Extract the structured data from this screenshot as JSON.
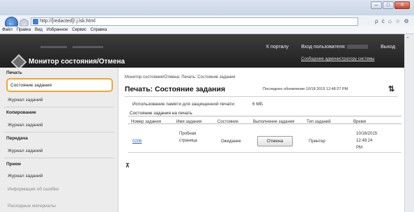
{
  "browser": {
    "url": "http://[redacted]/.j.lsk.html",
    "tools": [
      "ρ",
      "ċ",
      "⌂",
      "☆",
      "⚙"
    ],
    "window_buttons": [
      "–",
      "□",
      "✕"
    ],
    "menu": [
      "Файл",
      "Правка",
      "Вид",
      "Избранное",
      "Сервис",
      "Справка"
    ]
  },
  "header": {
    "title": "Монитор состояния/Отмена",
    "portal_link": "К порталу",
    "login_label": "Вход пользователя:",
    "logout_link": "Выход",
    "admin_message_link": "Сообщение администратору системы"
  },
  "sidebar": {
    "print_head": "Печать",
    "print_job_status": "Состояние задания",
    "print_job_log": "Журнал заданий",
    "copy_head": "Копирование",
    "copy_job_log": "Журнал заданий",
    "transmit_head": "Передача",
    "transmit_job_log": "Журнал заданий",
    "receive_head": "Прием",
    "receive_job_log": "Журнал заданий",
    "error_info": "Информация об ошибке",
    "consumables": "Расходные материалы"
  },
  "main": {
    "breadcrumb": "Монитор состояния/Отмена: Печать: Состояние задания",
    "title": "Печать: Состояние задания",
    "last_updated": "Последнее обновление:10/18 2015 12:48:27 PM",
    "memory_label": "Использование памяти для защищенной печати:",
    "memory_value": "6 MБ",
    "table_heading": "Состояние задания на печать",
    "columns": [
      "Номер задания",
      "Имя задания",
      "Состояние",
      "Выполнение задания",
      "Тип заданий",
      "Время"
    ],
    "job": {
      "number": "0206",
      "name_line1": "Пробная",
      "name_line2": "страница",
      "status": "Ожидание",
      "action": "Отмена",
      "type": "Принтер",
      "time_line1": "10/18/2015",
      "time_line2": "12:48:24",
      "time_line3": "PM"
    }
  }
}
